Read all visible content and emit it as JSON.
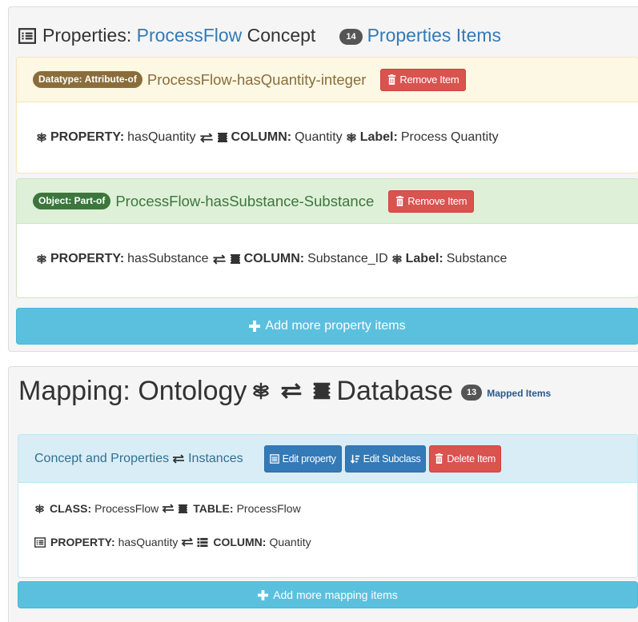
{
  "properties": {
    "header_prefix": "Properties:",
    "concept_name": "ProcessFlow",
    "concept_suffix": "Concept",
    "count": "14",
    "items_label": "Properties Items",
    "items": [
      {
        "type_label": "Datatype: Attribute-of",
        "name": "ProcessFlow-hasQuantity-integer",
        "remove_label": "Remove Item",
        "property_label": "PROPERTY:",
        "property_value": "hasQuantity",
        "column_label": "COLUMN:",
        "column_value": "Quantity",
        "label_label": "Label:",
        "label_value": "Process Quantity"
      },
      {
        "type_label": "Object: Part-of",
        "name": "ProcessFlow-hasSubstance-Substance",
        "remove_label": "Remove Item",
        "property_label": "PROPERTY:",
        "property_value": "hasSubstance",
        "column_label": "COLUMN:",
        "column_value": "Substance_ID",
        "label_label": "Label:",
        "label_value": "Substance"
      }
    ],
    "add_button": "Add more property items"
  },
  "mapping": {
    "title_left": "Mapping: Ontology",
    "title_right": "Database",
    "count": "13",
    "mapped_label": "Mapped Items",
    "instance": {
      "title_left": "Concept and Properties",
      "title_right": "Instances",
      "edit_property": "Edit property",
      "edit_subclass": "Edit Subclass",
      "delete_item": "Delete Item",
      "class_label": "CLASS:",
      "class_value": "ProcessFlow",
      "table_label": "TABLE:",
      "table_value": "ProcessFlow",
      "property_label": "PROPERTY:",
      "property_value": "hasQuantity",
      "column_label": "COLUMN:",
      "column_value": "Quantity"
    },
    "add_button": "Add more mapping items"
  },
  "colors": {
    "accent_blue": "#337ab7",
    "info": "#5bc0de",
    "danger": "#d9534f",
    "warning_text": "#8a6d3b",
    "success_text": "#3c763d"
  }
}
